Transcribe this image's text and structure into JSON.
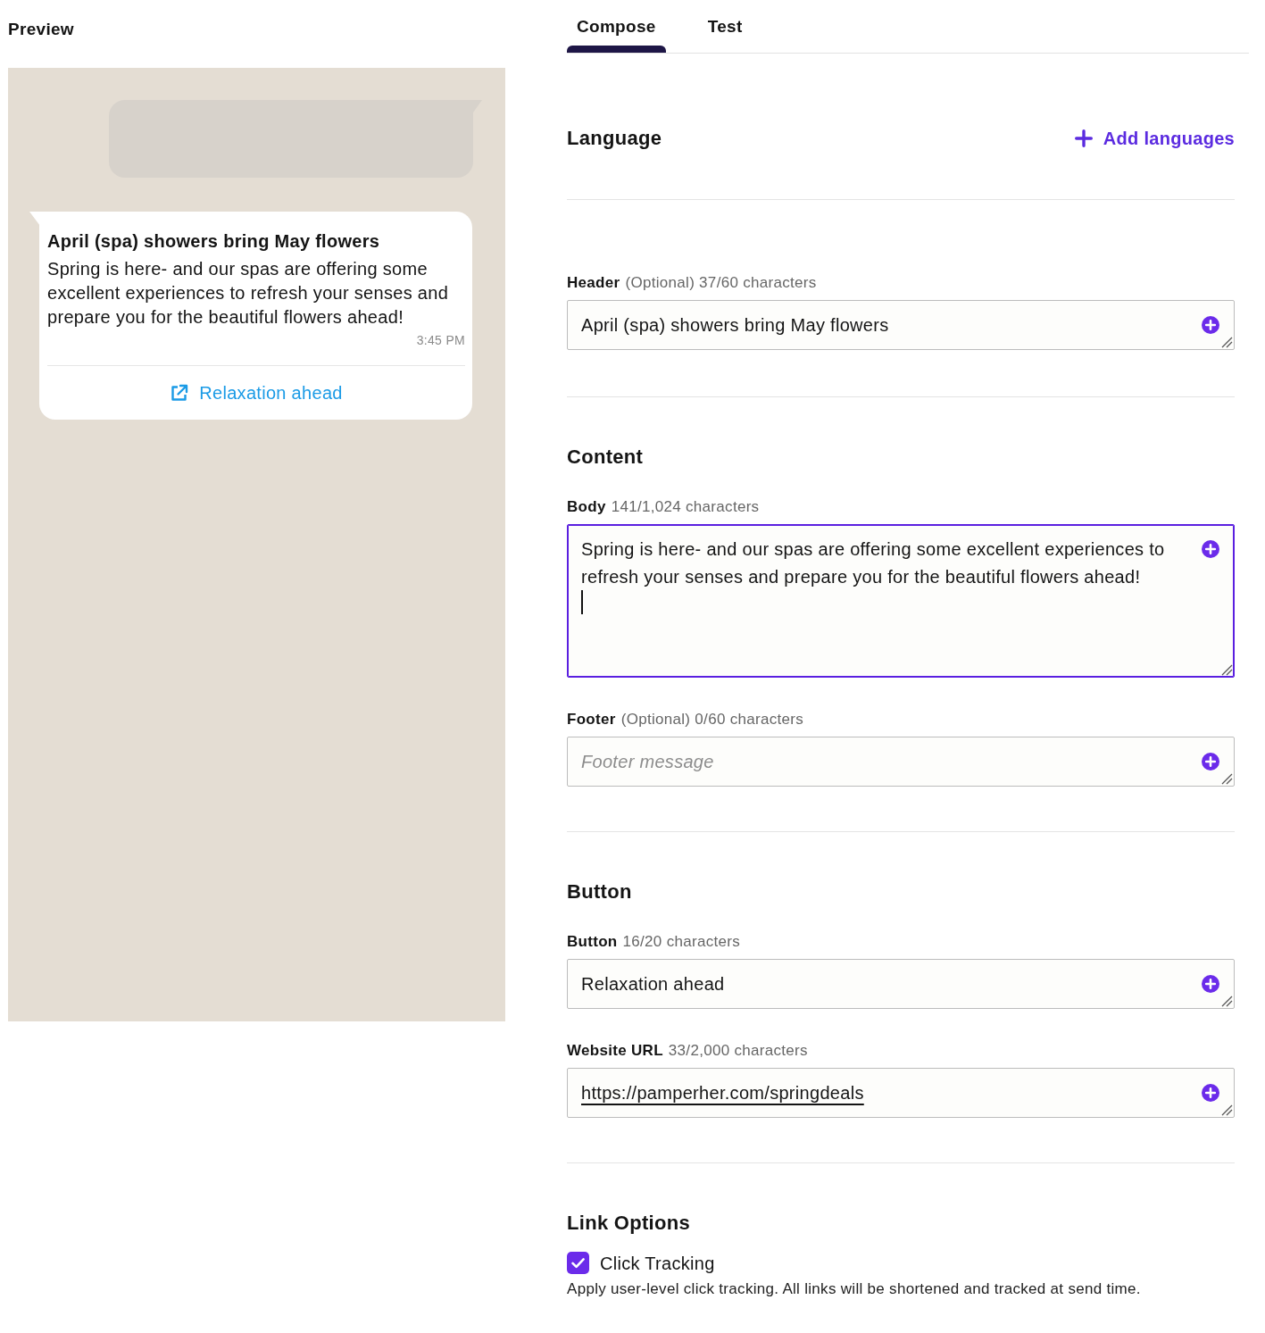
{
  "preview": {
    "title": "Preview",
    "message": {
      "header": "April (spa) showers bring May flowers",
      "body": "Spring is here- and our spas are offering some excellent experiences to refresh your senses and prepare you for the beautiful flowers ahead!",
      "time": "3:45 PM",
      "button": "Relaxation ahead"
    }
  },
  "tabs": [
    {
      "label": "Compose",
      "selected": true
    },
    {
      "label": "Test",
      "selected": false
    }
  ],
  "sections": [
    {
      "kind": "language",
      "title": "Language",
      "action": "Add languages"
    },
    {
      "kind": "fields",
      "fields": [
        {
          "kind": "text",
          "label": "Header",
          "hint": "(Optional) 37/60 characters",
          "value": "April (spa) showers bring May flowers",
          "focused": false
        }
      ]
    },
    {
      "kind": "fields",
      "title": "Content",
      "fields": [
        {
          "kind": "multiline",
          "label": "Body",
          "hint": "141/1,024 characters",
          "value": "Spring is here- and our spas are offering some excellent experiences to refresh your senses and prepare you for the beautiful flowers ahead!",
          "focused": true
        },
        {
          "kind": "text",
          "label": "Footer",
          "hint": "(Optional) 0/60 characters",
          "placeholder": "Footer message",
          "focused": false
        }
      ]
    },
    {
      "kind": "fields",
      "title": "Button",
      "fields": [
        {
          "kind": "text",
          "label": "Button",
          "hint": "16/20 characters",
          "value": "Relaxation ahead",
          "focused": false
        },
        {
          "kind": "url",
          "label": "Website URL",
          "hint": "33/2,000 characters",
          "value": "https://pamperher.com/springdeals",
          "focused": false
        }
      ]
    },
    {
      "kind": "options",
      "title": "Link Options",
      "options": [
        {
          "label": "Click Tracking",
          "checked": true,
          "description": "Apply user-level click tracking. All links will be shortened and tracked at send time."
        }
      ]
    }
  ]
}
